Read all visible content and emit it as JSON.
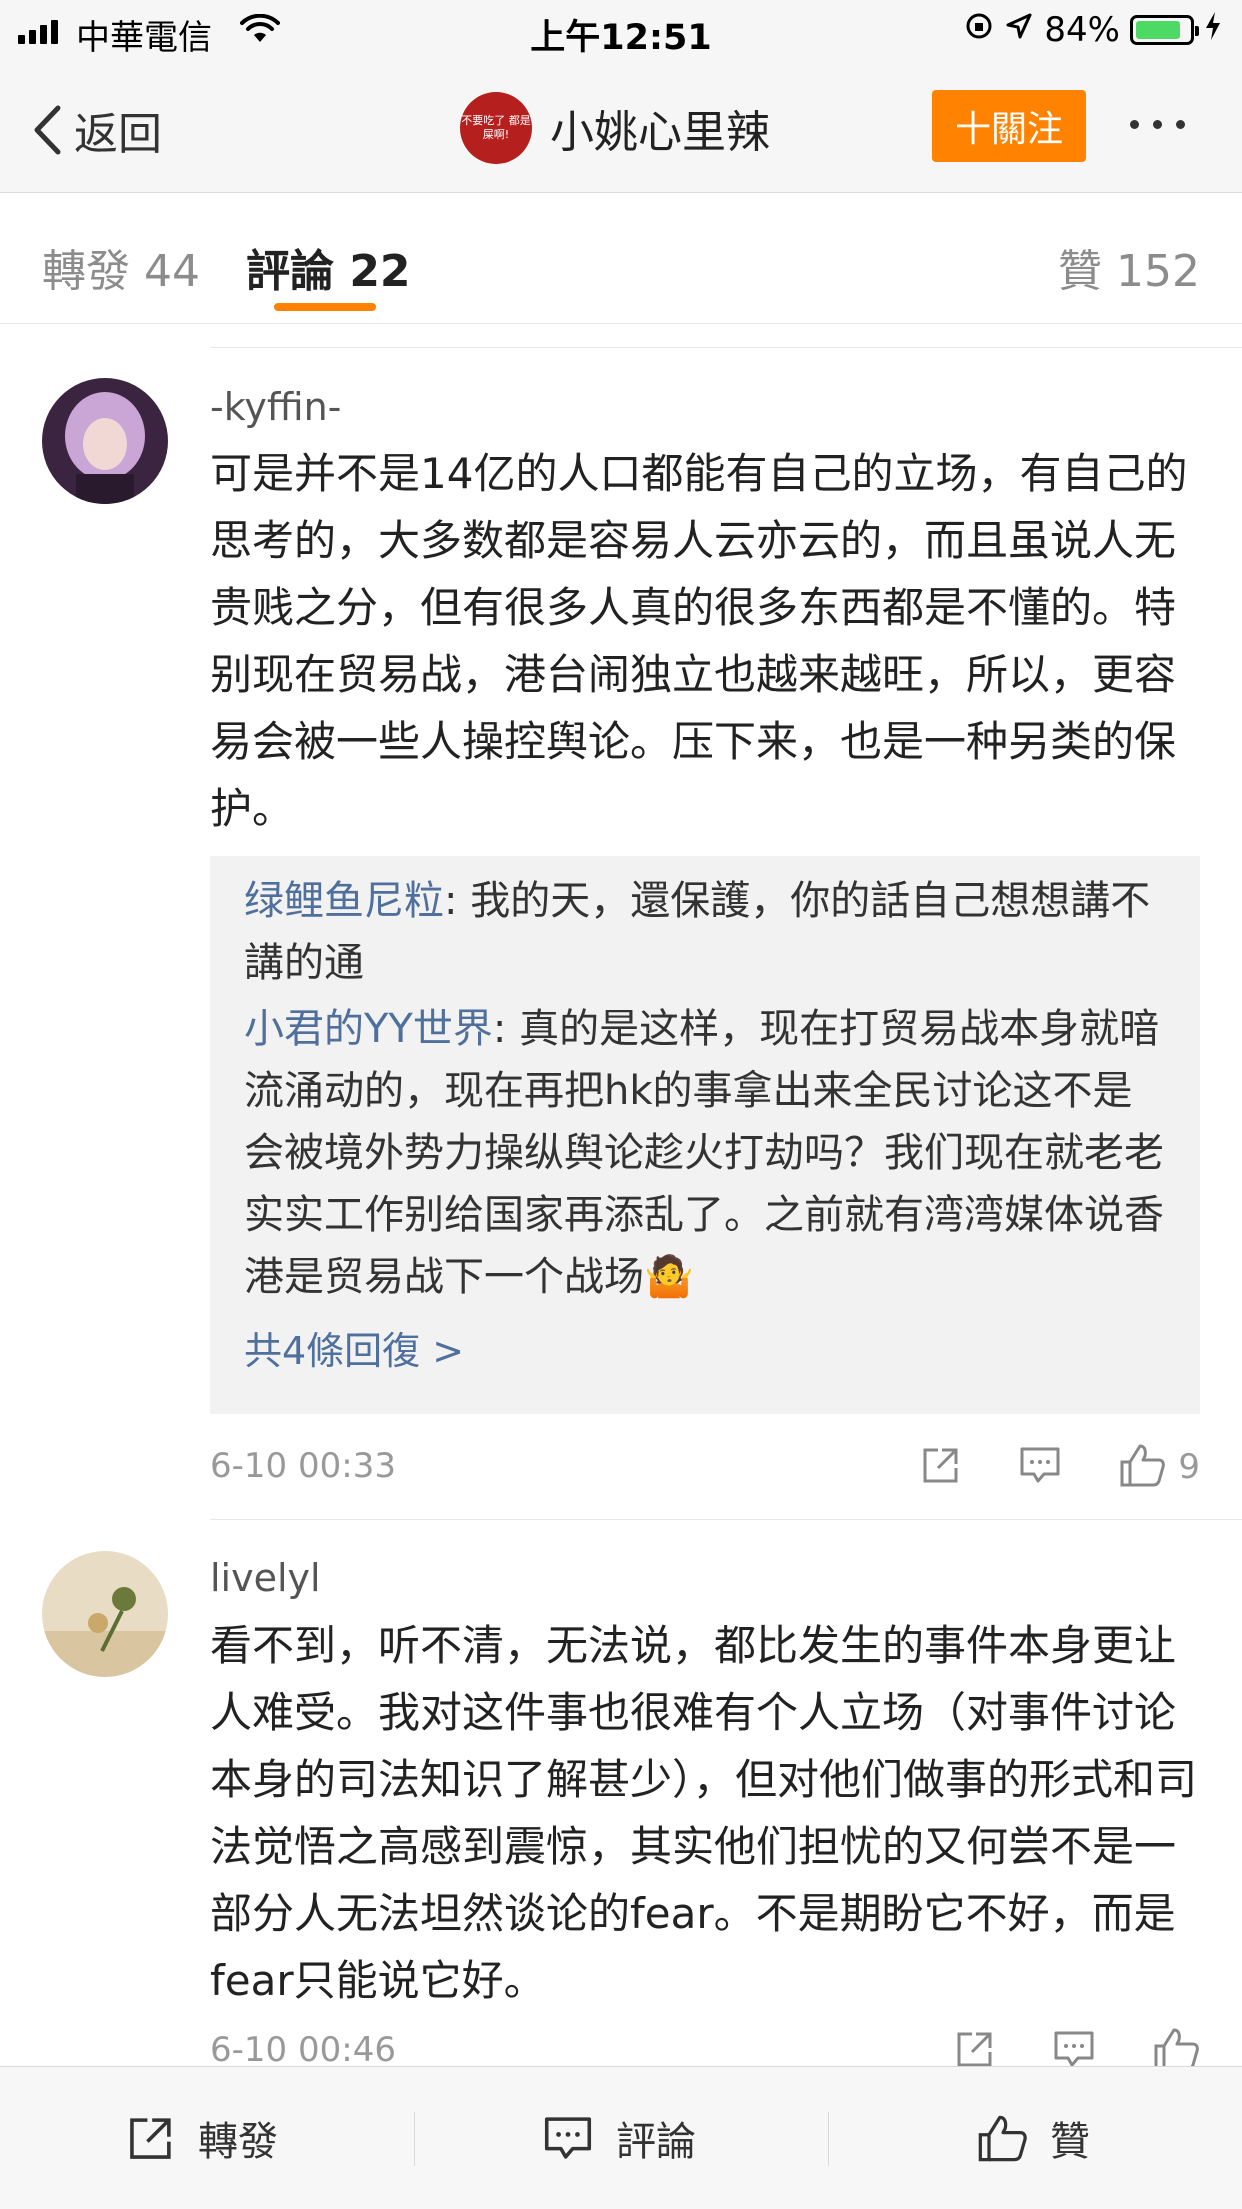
{
  "status": {
    "carrier": "中華電信",
    "time": "上午12:51",
    "battery": "84%",
    "battery_level": 0.84
  },
  "nav": {
    "back_label": "返回",
    "title": "小姚心里辣",
    "avatar_text": "不要吃了 都是屎啊!",
    "follow_label": "十關注"
  },
  "tabs": {
    "repost": "轉發 44",
    "comments": "評論 22",
    "likes": "贊 152"
  },
  "comments": [
    {
      "user": "-kyffin-",
      "text": "可是并不是14亿的人口都能有自己的立场，有自己的思考的，大多数都是容易人云亦云的，而且虽说人无贵贱之分，但有很多人真的很多东西都是不懂的。特别现在贸易战，港台闹独立也越来越旺，所以，更容易会被一些人操控舆论。压下来，也是一种另类的保护。",
      "replies": [
        {
          "name": "绿鲤鱼尼粒",
          "text": ": 我的天，還保護，你的話自己想想講不講的通"
        },
        {
          "name": "小君的YY世界",
          "text": ": 真的是这样，现在打贸易战本身就暗流涌动的，现在再把hk的事拿出来全民讨论这不是会被境外势力操纵舆论趁火打劫吗？我们现在就老老实实工作别给国家再添乱了。之前就有湾湾媒体说香港是贸易战下一个战场🤷"
        }
      ],
      "more_replies": "共4條回復 >",
      "time": "6-10 00:33",
      "likes": "9"
    },
    {
      "user": "livelyl",
      "text": "看不到，听不清，无法说，都比发生的事件本身更让人难受。我对这件事也很难有个人立场（对事件讨论本身的司法知识了解甚少），但对他们做事的形式和司法觉悟之高感到震惊，其实他们担忧的又何尝不是一部分人无法坦然谈论的fear。不是期盼它不好，而是fear只能说它好。",
      "time": "6-10 00:46"
    }
  ],
  "bottom": {
    "repost": "轉發",
    "comment": "評論",
    "like": "贊"
  },
  "colors": {
    "accent": "#ff8200",
    "link": "#4f6f9c",
    "battery": "#4cd964"
  }
}
